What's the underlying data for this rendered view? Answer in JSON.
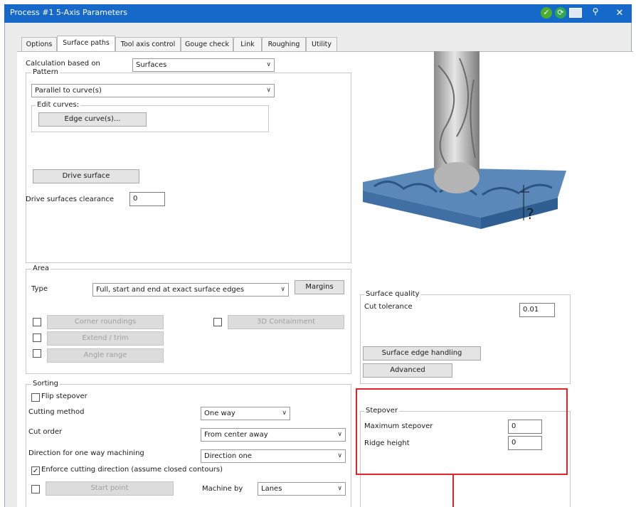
{
  "window": {
    "title": "Process #1 5-Axis Parameters",
    "title_icons": [
      "ok-check-icon",
      "refresh-icon",
      "copy-window-icon",
      "pin-icon"
    ],
    "close_glyph": "✕"
  },
  "tabs": [
    "Options",
    "Surface paths",
    "Tool axis control",
    "Gouge check",
    "Link",
    "Roughing",
    "Utility"
  ],
  "calc": {
    "label": "Calculation based on",
    "value": "Surfaces"
  },
  "pattern": {
    "legend": "Pattern",
    "value": "Parallel to curve(s)",
    "edit_legend": "Edit curves:",
    "edge_button": "Edge curve(s)...",
    "drive_button": "Drive surface",
    "clearance_label": "Drive surfaces clearance",
    "clearance_value": "0"
  },
  "area": {
    "legend": "Area",
    "type_label": "Type",
    "type_value": "Full, start and end at exact surface edges",
    "margins_button": "Margins",
    "corner_roundings": "Corner roundings",
    "extend_trim": "Extend / trim",
    "angle_range": "Angle range",
    "containment": "3D Containment"
  },
  "surface_quality": {
    "legend": "Surface quality",
    "cut_tolerance_label": "Cut tolerance",
    "cut_tolerance_value": "0.01",
    "edge_handling_button": "Surface edge handling",
    "advanced_button": "Advanced"
  },
  "sorting": {
    "legend": "Sorting",
    "flip_label": "Flip stepover",
    "cutting_method_label": "Cutting method",
    "cutting_method_value": "One way",
    "cut_order_label": "Cut order",
    "cut_order_value": "From center away",
    "direction_label": "Direction for one way machining",
    "direction_value": "Direction one",
    "enforce_label": "Enforce cutting direction (assume closed contours)",
    "start_point": "Start point",
    "machine_by_label": "Machine by",
    "machine_by_value": "Lanes"
  },
  "stepover": {
    "legend": "Stepover",
    "max_label": "Maximum stepover",
    "max_value": "0",
    "ridge_label": "Ridge height",
    "ridge_value": "0"
  },
  "preview": {
    "question_mark": "?"
  },
  "colors": {
    "title_bar": "#1769c9",
    "highlight": "#e0262c",
    "part": "#4f7fb0",
    "tool": "#a9a9a9"
  }
}
